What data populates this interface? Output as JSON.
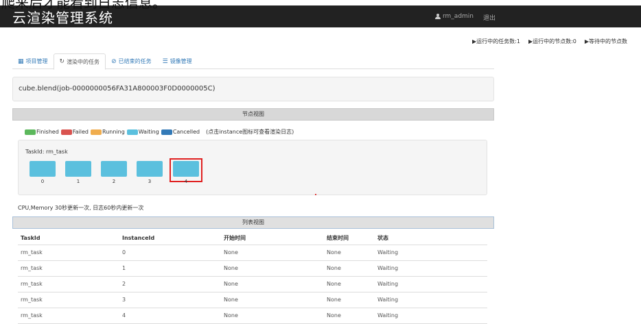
{
  "overlay": {
    "text": "爬来后才能看到日志信息。"
  },
  "navbar": {
    "brand": "云渲染管理系统",
    "user": "rm_admin",
    "logout": "退出"
  },
  "stats": {
    "running_tasks": "▶运行中的任务数:1",
    "running_nodes": "▶运行中的节点数:0",
    "waiting_nodes": "▶等待中的节点数"
  },
  "tabs": [
    {
      "label": "项目管理",
      "icon": "grid-icon",
      "active": false
    },
    {
      "label": "渲染中的任务",
      "icon": "refresh-icon",
      "active": true
    },
    {
      "label": "已结束的任务",
      "icon": "check-circle-icon",
      "active": false
    },
    {
      "label": "镜像管理",
      "icon": "list-icon",
      "active": false
    }
  ],
  "job": {
    "title": "cube.blend(job-0000000056FA31A800003F0D0000005C)"
  },
  "node_view": {
    "header": "节点视图",
    "legend": [
      {
        "label": "Finished",
        "color": "#5cb85c"
      },
      {
        "label": "Failed",
        "color": "#d9534f"
      },
      {
        "label": "Running",
        "color": "#f0ad4e"
      },
      {
        "label": "Waiting",
        "color": "#5bc0de"
      },
      {
        "label": "Cancelled",
        "color": "#337ab7"
      }
    ],
    "legend_hint": "(点击instance图标可查看渲染日志)",
    "task_id": "TaskId: rm_task",
    "nodes": [
      "0",
      "1",
      "2",
      "3",
      "4"
    ],
    "node_color": "#5bc0de",
    "highlight_color": "#e02020"
  },
  "refresh_note": "CPU,Memory 30秒更新一次, 日志60秒内更新一次",
  "list_view": {
    "header": "列表视图",
    "columns": [
      "TaskId",
      "InstanceId",
      "开始时间",
      "结束时间",
      "状态"
    ],
    "rows": [
      [
        "rm_task",
        "0",
        "None",
        "None",
        "Waiting"
      ],
      [
        "rm_task",
        "1",
        "None",
        "None",
        "Waiting"
      ],
      [
        "rm_task",
        "2",
        "None",
        "None",
        "Waiting"
      ],
      [
        "rm_task",
        "3",
        "None",
        "None",
        "Waiting"
      ],
      [
        "rm_task",
        "4",
        "None",
        "None",
        "Waiting"
      ]
    ]
  }
}
